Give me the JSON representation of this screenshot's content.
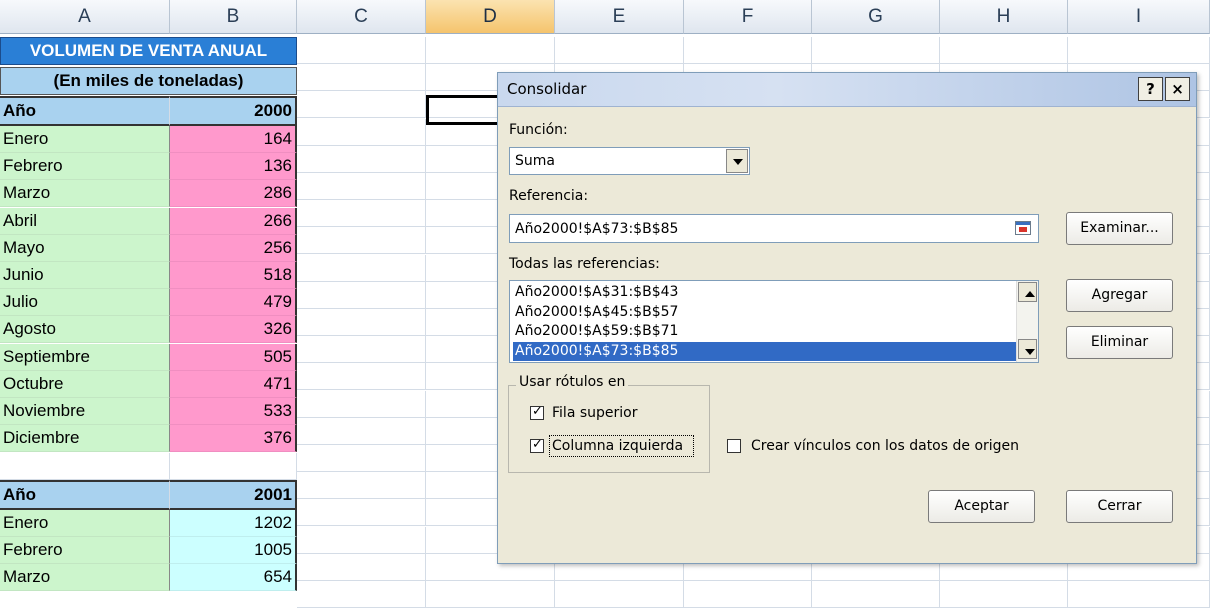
{
  "sheet": {
    "columns": [
      "A",
      "B",
      "C",
      "D",
      "E",
      "F",
      "G",
      "H",
      "I"
    ],
    "title": "VOLUMEN DE VENTA ANUAL",
    "subtitle": "(En miles de toneladas)",
    "block1": {
      "header_label": "Año",
      "year": "2000",
      "rows": [
        [
          "Enero",
          "164"
        ],
        [
          "Febrero",
          "136"
        ],
        [
          "Marzo",
          "286"
        ],
        [
          "Abril",
          "266"
        ],
        [
          "Mayo",
          "256"
        ],
        [
          "Junio",
          "518"
        ],
        [
          "Julio",
          "479"
        ],
        [
          "Agosto",
          "326"
        ],
        [
          "Septiembre",
          "505"
        ],
        [
          "Octubre",
          "471"
        ],
        [
          "Noviembre",
          "533"
        ],
        [
          "Diciembre",
          "376"
        ]
      ]
    },
    "block2": {
      "header_label": "Año",
      "year": "2001",
      "rows": [
        [
          "Enero",
          "1202"
        ],
        [
          "Febrero",
          "1005"
        ],
        [
          "Marzo",
          "654"
        ]
      ]
    },
    "selected_column": "D"
  },
  "dialog": {
    "title": "Consolidar",
    "help_button": "?",
    "close_button": "×",
    "funcion_label": "Función:",
    "funcion_value": "Suma",
    "referencia_label": "Referencia:",
    "referencia_value": "Año2000!$A$73:$B$85",
    "examinar_button": "Examinar...",
    "todas_label": "Todas las referencias:",
    "references": [
      "Año2000!$A$31:$B$43",
      "Año2000!$A$45:$B$57",
      "Año2000!$A$59:$B$71",
      "Año2000!$A$73:$B$85"
    ],
    "selected_reference_index": 3,
    "agregar_button": "Agregar",
    "eliminar_button": "Eliminar",
    "usar_rotulos_label": "Usar rótulos en",
    "fila_superior_label": "Fila superior",
    "fila_superior_checked": true,
    "columna_izquierda_label": "Columna izquierda",
    "columna_izquierda_checked": true,
    "crear_vinculos_label": "Crear vínculos con los datos de origen",
    "crear_vinculos_checked": false,
    "aceptar_button": "Aceptar",
    "cerrar_button": "Cerrar"
  }
}
